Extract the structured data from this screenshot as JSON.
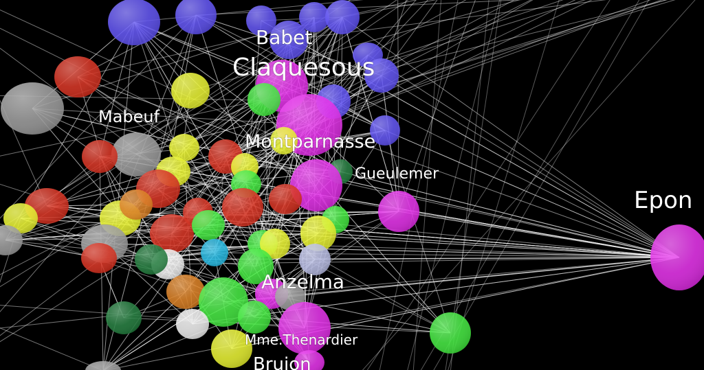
{
  "graph": {
    "background": "#000000",
    "edge_color": "#ffffff",
    "labels": [
      {
        "id": "babet",
        "text": "Babet"
      },
      {
        "id": "claquesous",
        "text": "Claquesous"
      },
      {
        "id": "mabeuf",
        "text": "Mabeuf"
      },
      {
        "id": "montparnasse",
        "text": "Montparnasse"
      },
      {
        "id": "gueulemer",
        "text": "Gueulemer"
      },
      {
        "id": "eponine",
        "text": "Epon"
      },
      {
        "id": "anzelma",
        "text": "Anzelma"
      },
      {
        "id": "mme-thenardier",
        "text": "Mme.Thenardier"
      },
      {
        "id": "brujon",
        "text": "Brujon"
      }
    ],
    "colors": {
      "blue": "#5b4df0",
      "magenta": "#e22ae8",
      "red": "#d42b1a",
      "yellow": "#e6f02a",
      "green": "#3ee63a",
      "gray": "#9a9a9a",
      "orange": "#d87b1c",
      "white": "#eeeeee",
      "cyan": "#1fb6e0",
      "darkgreen": "#1f7a3a",
      "lavender": "#b4b8e0"
    }
  }
}
